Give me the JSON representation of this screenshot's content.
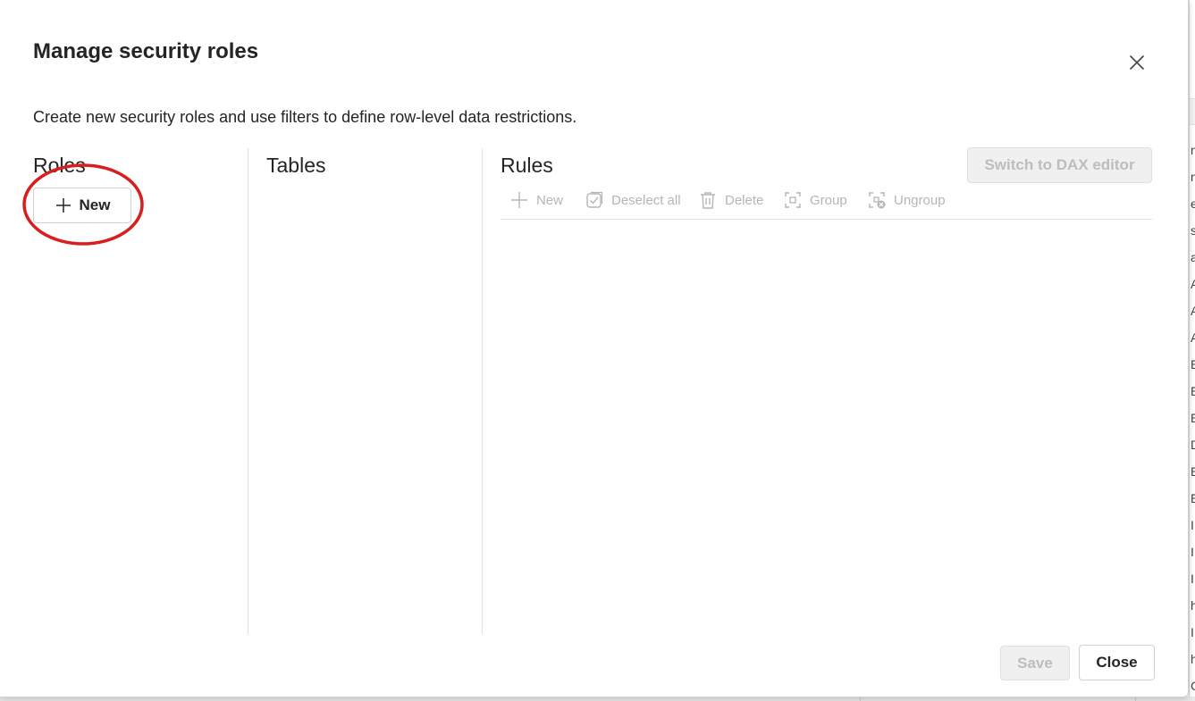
{
  "dialog": {
    "title": "Manage security roles",
    "subtitle": "Create new security roles and use filters to define row-level data restrictions.",
    "close_icon": "close-icon"
  },
  "roles": {
    "heading": "Roles",
    "new_button": {
      "label": "New",
      "icon": "plus-icon"
    }
  },
  "tables": {
    "heading": "Tables"
  },
  "rules": {
    "heading": "Rules",
    "switch_dax_label": "Switch to DAX editor",
    "toolbar": [
      {
        "label": "New",
        "icon": "plus-icon"
      },
      {
        "label": "Deselect all",
        "icon": "checkbox-icon"
      },
      {
        "label": "Delete",
        "icon": "trash-icon"
      },
      {
        "label": "Group",
        "icon": "group-icon"
      },
      {
        "label": "Ungroup",
        "icon": "ungroup-icon"
      }
    ]
  },
  "footer": {
    "save_label": "Save",
    "close_label": "Close"
  },
  "background_letters": [
    "n",
    "n",
    "es",
    "s",
    "a",
    "A",
    "A",
    "A",
    "E",
    "E",
    "E",
    "D",
    "E",
    "E",
    "I",
    "I",
    "I",
    "h",
    "I",
    "h",
    "C"
  ],
  "colors": {
    "text": "#242424",
    "disabled_text": "#b5b5b5",
    "annotation_ring": "#d81e1e",
    "border": "#d1d1d1"
  }
}
